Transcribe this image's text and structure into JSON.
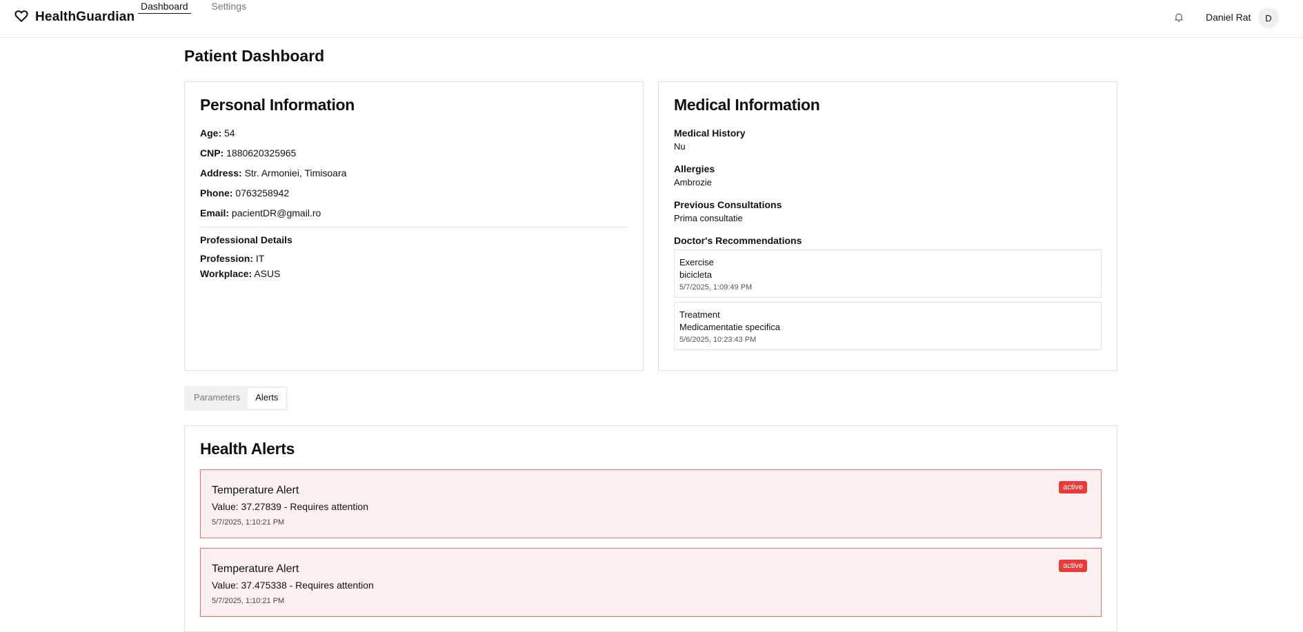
{
  "app": {
    "name": "HealthGuardian",
    "nav": [
      {
        "label": "Dashboard",
        "active": true
      },
      {
        "label": "Settings",
        "active": false
      }
    ],
    "user": {
      "name": "Daniel Rat",
      "initial": "D"
    }
  },
  "page": {
    "title": "Patient Dashboard"
  },
  "personal": {
    "title": "Personal Information",
    "fields": [
      {
        "label": "Age:",
        "value": "54"
      },
      {
        "label": "CNP:",
        "value": "1880620325965"
      },
      {
        "label": "Address:",
        "value": "Str. Armoniei, Timisoara"
      },
      {
        "label": "Phone:",
        "value": "0763258942"
      },
      {
        "label": "Email:",
        "value": "pacientDR@gmail.ro"
      }
    ],
    "professional": {
      "title": "Professional Details",
      "fields": [
        {
          "label": "Profession:",
          "value": "IT"
        },
        {
          "label": "Workplace:",
          "value": "ASUS"
        }
      ]
    }
  },
  "medical": {
    "title": "Medical Information",
    "sections": [
      {
        "label": "Medical History",
        "value": "Nu"
      },
      {
        "label": "Allergies",
        "value": "Ambrozie"
      },
      {
        "label": "Previous Consultations",
        "value": "Prima consultatie"
      }
    ],
    "recommendations_label": "Doctor's Recommendations",
    "recommendations": [
      {
        "type": "Exercise",
        "text": "bicicleta",
        "date": "5/7/2025, 1:09:49 PM"
      },
      {
        "type": "Treatment",
        "text": "Medicamentatie specifica",
        "date": "5/6/2025, 10:23:43 PM"
      }
    ]
  },
  "tabs": [
    {
      "label": "Parameters",
      "active": false
    },
    {
      "label": "Alerts",
      "active": true
    }
  ],
  "alerts": {
    "title": "Health Alerts",
    "items": [
      {
        "title": "Temperature Alert",
        "value_text": "Value: 37.27839 - Requires attention",
        "date": "5/7/2025, 1:10:21 PM",
        "status": "active"
      },
      {
        "title": "Temperature Alert",
        "value_text": "Value: 37.475338 - Requires attention",
        "date": "5/7/2025, 1:10:21 PM",
        "status": "active"
      }
    ]
  },
  "colors": {
    "alert_background": "#fdf0f0",
    "alert_border": "#f26b6b",
    "badge": "#ea3b3b"
  }
}
